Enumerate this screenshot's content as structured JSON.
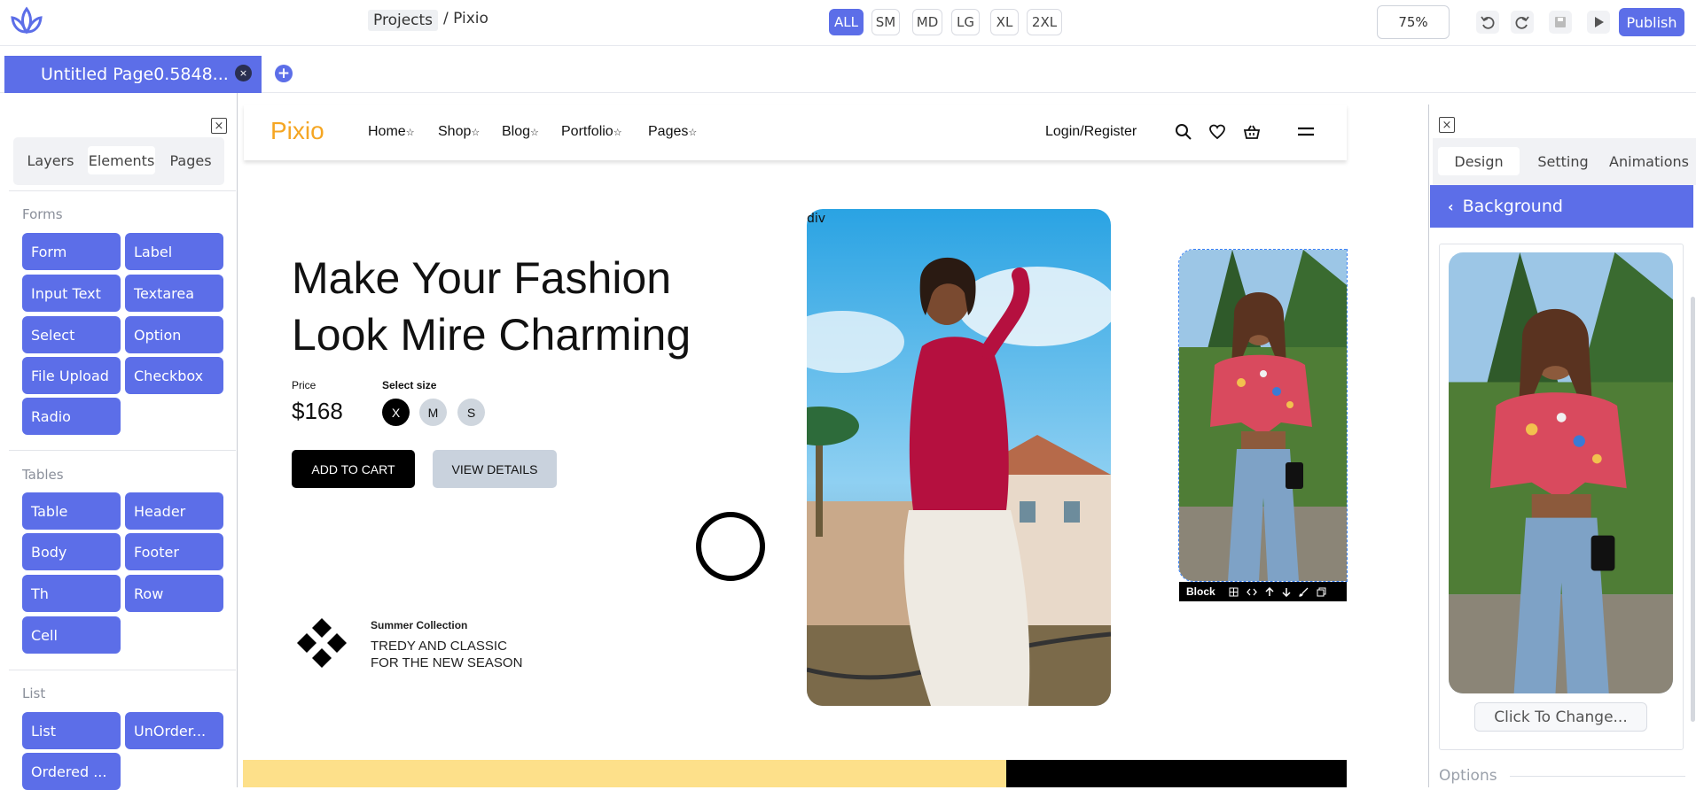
{
  "topbar": {
    "breadcrumb": {
      "projects": "Projects",
      "separator": "/",
      "current": "Pixio"
    },
    "breakpoints": [
      "ALL",
      "SM",
      "MD",
      "LG",
      "XL",
      "2XL"
    ],
    "zoom": "75%",
    "publish_label": "Publish"
  },
  "tabs": {
    "page_tab_label": "Untitled Page0.5848...",
    "close_symbol": "×",
    "add_symbol": "+"
  },
  "left_panel": {
    "close_symbol": "×",
    "tabs": [
      "Layers",
      "Elements",
      "Pages"
    ],
    "active_tab": "Elements",
    "sections": {
      "forms": {
        "title": "Forms",
        "items": [
          "Form",
          "Label",
          "Input Text",
          "Textarea",
          "Select",
          "Option",
          "File Upload",
          "Checkbox",
          "Radio"
        ]
      },
      "tables": {
        "title": "Tables",
        "items": [
          "Table",
          "Header",
          "Body",
          "Footer",
          "Th",
          "Row",
          "Cell"
        ]
      },
      "list": {
        "title": "List",
        "items": [
          "List",
          "UnOrder...",
          "Ordered ..."
        ]
      }
    }
  },
  "site": {
    "logo": "Pixio",
    "nav": [
      "Home",
      "Shop",
      "Blog",
      "Portfolio",
      "Pages"
    ],
    "nav_suffix": "☆",
    "login": "Login/Register",
    "hero_title_line1": "Make Your Fashion",
    "hero_title_line2": "Look Mire Charming",
    "price_label": "Price",
    "price": "$168",
    "size_label": "Select size",
    "sizes": [
      "X",
      "M",
      "S"
    ],
    "selected_size": "X",
    "add_to_cart": "ADD TO CART",
    "view_details": "VIEW DETAILS",
    "collection_title": "Summer Collection",
    "collection_line1": "TREDY AND CLASSIC",
    "collection_line2": "FOR THE NEW SEASON",
    "div_label": "div",
    "block_label": "Block"
  },
  "right_panel": {
    "close_symbol": "×",
    "tabs": [
      "Design",
      "Setting",
      "Animations"
    ],
    "active_tab": "Design",
    "section_title": "Background",
    "change_button": "Click To Change...",
    "options_label": "Options"
  },
  "colors": {
    "accent": "#5c6ee8",
    "logo": "#f5a623",
    "band_yellow": "#fde08a"
  }
}
